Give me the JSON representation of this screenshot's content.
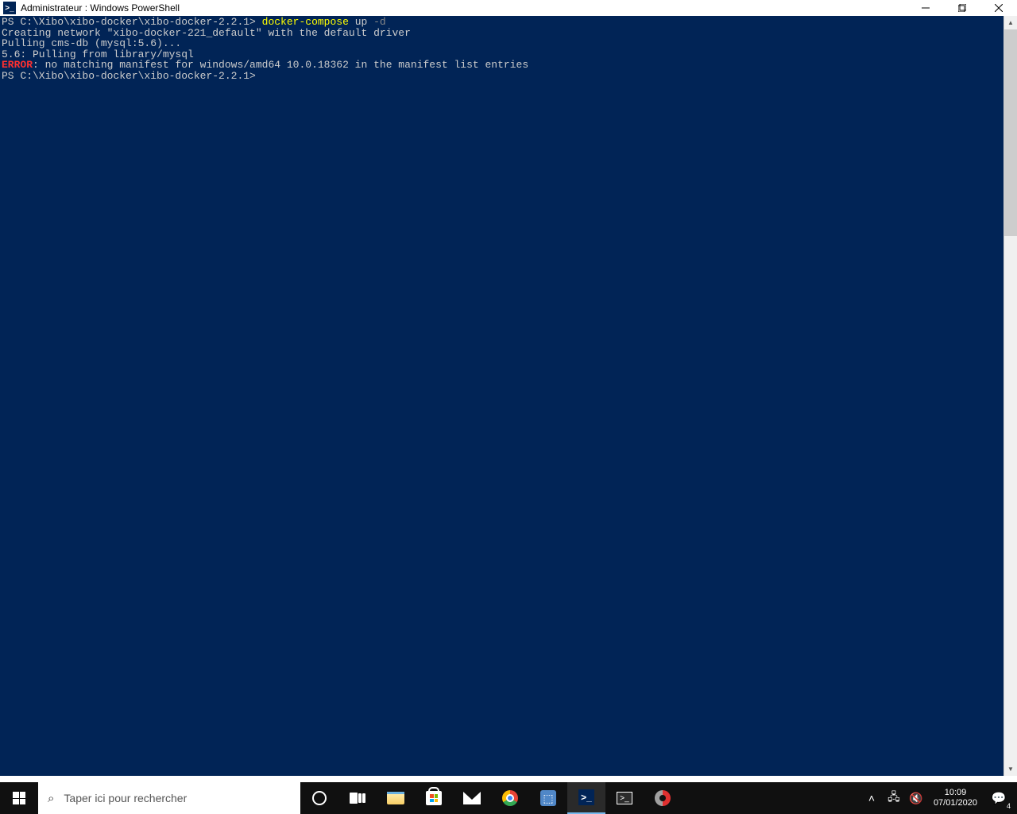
{
  "window": {
    "title": "Administrateur : Windows PowerShell"
  },
  "terminal": {
    "prompt1": "PS C:\\Xibo\\xibo-docker\\xibo-docker-2.2.1> ",
    "cmd1_a": "docker-compose ",
    "cmd1_b": "up ",
    "cmd1_c": "-d",
    "line2": "Creating network \"xibo-docker-221_default\" with the default driver",
    "line3": "Pulling cms-db (mysql:5.6)...",
    "line4": "5.6: Pulling from library/mysql",
    "line5_err": "ERROR",
    "line5_rest": ": no matching manifest for windows/amd64 10.0.18362 in the manifest list entries",
    "prompt2": "PS C:\\Xibo\\xibo-docker\\xibo-docker-2.2.1>"
  },
  "taskbar": {
    "search_placeholder": "Taper ici pour rechercher",
    "time": "10:09",
    "date": "07/01/2020",
    "action_badge": "4"
  }
}
